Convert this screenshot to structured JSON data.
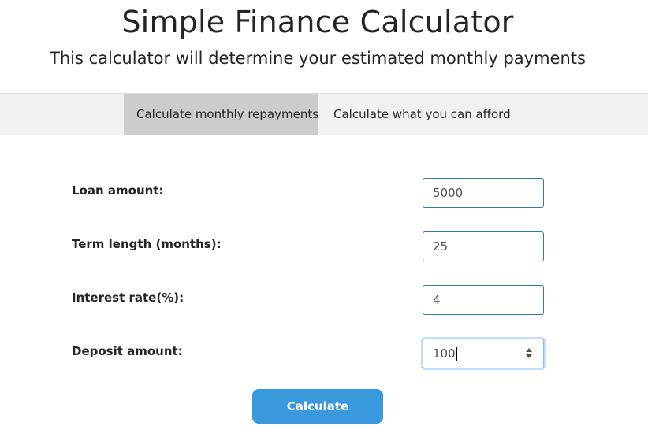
{
  "header": {
    "title": "Simple Finance Calculator",
    "subtitle": "This calculator will determine your estimated monthly payments"
  },
  "tabs": [
    {
      "label": "Calculate monthly repayments",
      "active": true
    },
    {
      "label": "Calculate what you can afford",
      "active": false
    }
  ],
  "form": {
    "loan_amount": {
      "label": "Loan amount:",
      "value": "5000"
    },
    "term_length": {
      "label": "Term length (months):",
      "value": "25"
    },
    "interest_rate": {
      "label": "Interest rate(%):",
      "value": "4"
    },
    "deposit_amount": {
      "label": "Deposit amount:",
      "value": "100"
    }
  },
  "actions": {
    "calculate_label": "Calculate"
  },
  "colors": {
    "button": "#3a98dc",
    "active_tab": "#cccccc",
    "tab_bar": "#f1f1f1",
    "input_border": "#2e7fa6"
  }
}
